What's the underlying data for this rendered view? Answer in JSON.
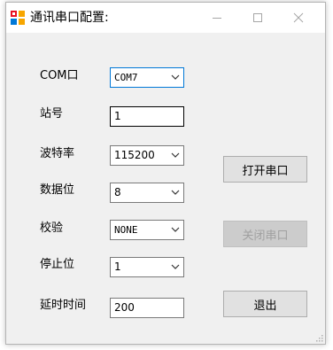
{
  "window": {
    "title": "通讯串口配置:",
    "title_icons": [
      "app-icon",
      "minimize-icon",
      "maximize-icon",
      "close-icon"
    ]
  },
  "form": {
    "com": {
      "label": "COM口",
      "value": "COM7"
    },
    "station": {
      "label": "站号",
      "value": "1"
    },
    "baud": {
      "label": "波特率",
      "value": "115200"
    },
    "databits": {
      "label": "数据位",
      "value": "8"
    },
    "parity": {
      "label": "校验",
      "value": "NONE"
    },
    "stopbits": {
      "label": "停止位",
      "value": "1"
    },
    "delay": {
      "label": "延时时间",
      "value": "200"
    }
  },
  "buttons": {
    "open": "打开串口",
    "close": "关闭串口",
    "exit": "退出"
  },
  "colors": {
    "focus_border": "#0078d7",
    "disabled_text": "#a0a0a0",
    "button_face": "#e1e1e1",
    "window_bg": "#f0f0f0"
  }
}
